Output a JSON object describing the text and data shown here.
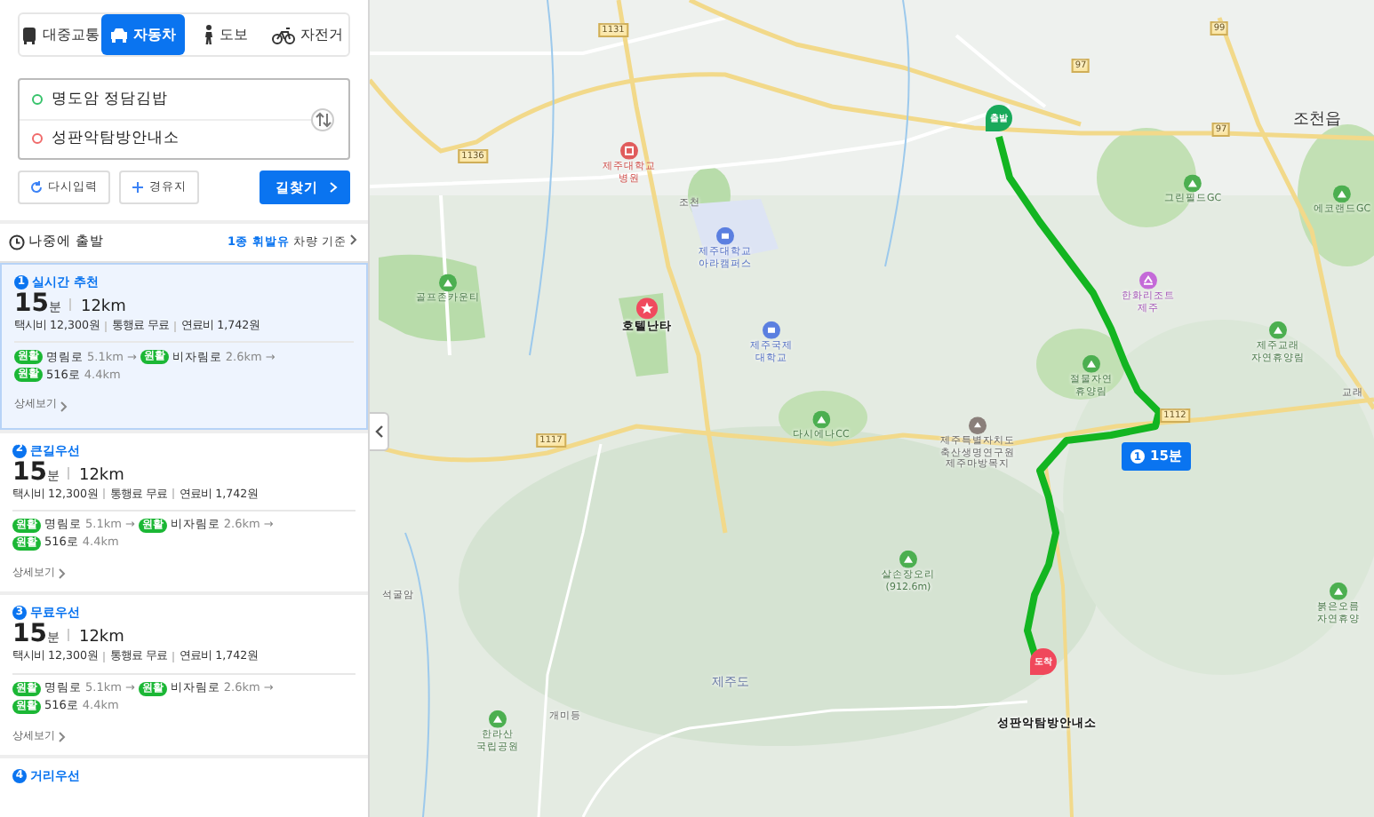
{
  "modes": [
    {
      "label": "대중교통",
      "kind": "bus",
      "selected": false
    },
    {
      "label": "자동차",
      "kind": "car",
      "selected": true
    },
    {
      "label": "도보",
      "kind": "walk",
      "selected": false
    },
    {
      "label": "자전거",
      "kind": "bike",
      "selected": false
    }
  ],
  "route_inputs": {
    "origin": "명도암 정담김밥",
    "destination": "성판악탐방안내소"
  },
  "actions": {
    "reset": "다시입력",
    "waypoint": "경유지",
    "search": "길찾기"
  },
  "departure": {
    "label": "나중에 출발",
    "vehicle": "**1종 휘발유** 차량 기준"
  },
  "routes": [
    {
      "number": "1",
      "title": "실시간 추천",
      "selected": true,
      "time": "15",
      "time_unit": "분",
      "distance": "12km",
      "costs": [
        "택시비 12,300원",
        "통행료 무료",
        "연료비 1,742원"
      ],
      "roads": [
        {
          "status": "원활",
          "name": "명림로",
          "length": "5.1km",
          "arrow": "→"
        },
        {
          "status": "원활",
          "name": "비자림로",
          "length": "2.6km",
          "arrow": "→"
        },
        {
          "status": "원활",
          "name": "516로",
          "length": "4.4km"
        }
      ],
      "details": "상세보기"
    },
    {
      "number": "2",
      "title": "큰길우선",
      "selected": false,
      "time": "15",
      "time_unit": "분",
      "distance": "12km",
      "costs": [
        "택시비 12,300원",
        "통행료 무료",
        "연료비 1,742원"
      ],
      "roads": [
        {
          "status": "원활",
          "name": "명림로",
          "length": "5.1km",
          "arrow": "→"
        },
        {
          "status": "원활",
          "name": "비자림로",
          "length": "2.6km",
          "arrow": "→"
        },
        {
          "status": "원활",
          "name": "516로",
          "length": "4.4km"
        }
      ],
      "details": "상세보기"
    },
    {
      "number": "3",
      "title": "무료우선",
      "selected": false,
      "time": "15",
      "time_unit": "분",
      "distance": "12km",
      "costs": [
        "택시비 12,300원",
        "통행료 무료",
        "연료비 1,742원"
      ],
      "roads": [
        {
          "status": "원활",
          "name": "명림로",
          "length": "5.1km",
          "arrow": "→"
        },
        {
          "status": "원활",
          "name": "비자림로",
          "length": "2.6km",
          "arrow": "→"
        },
        {
          "status": "원활",
          "name": "516로",
          "length": "4.4km"
        }
      ],
      "details": "상세보기"
    },
    {
      "number": "4",
      "title": "거리우선",
      "selected": false
    }
  ],
  "map": {
    "labels": [
      {
        "kind": "road",
        "text": "1131"
      },
      {
        "kind": "road",
        "text": "1136"
      },
      {
        "kind": "hospital",
        "text": "제주대학교\n병원"
      },
      {
        "kind": "place",
        "text": "조천"
      },
      {
        "kind": "school",
        "text": "제주대학교\n아라캠퍼스"
      },
      {
        "kind": "park",
        "text": "골프존카운티"
      },
      {
        "kind": "star",
        "text": "호텔난타"
      },
      {
        "kind": "school",
        "text": "제주국제\n대학교"
      },
      {
        "kind": "road",
        "text": "97"
      },
      {
        "kind": "road",
        "text": "99"
      },
      {
        "kind": "road",
        "text": "97"
      },
      {
        "kind": "town",
        "text": "조천읍"
      },
      {
        "kind": "park",
        "text": "그린필드GC"
      },
      {
        "kind": "park",
        "text": "에코랜드GC"
      },
      {
        "kind": "resort",
        "text": "한화리조트\n제주"
      },
      {
        "kind": "park",
        "text": "제주교래\n자연휴양림"
      },
      {
        "kind": "park",
        "text": "절물자연\n휴양림"
      },
      {
        "kind": "road",
        "text": "1117"
      },
      {
        "kind": "road",
        "text": "1112"
      },
      {
        "kind": "park",
        "text": "다시에나CC"
      },
      {
        "kind": "poi",
        "text": "제주특별자치도\n축산생명연구원\n제주마방목지"
      },
      {
        "kind": "park",
        "text": "살손장오리\n(912.6m)"
      },
      {
        "kind": "area",
        "text": "제주도"
      },
      {
        "kind": "park",
        "text": "한라산\n국립공원"
      },
      {
        "kind": "place",
        "text": "석굴암"
      },
      {
        "kind": "place",
        "text": "개미등"
      },
      {
        "kind": "place",
        "text": "교래"
      },
      {
        "kind": "park",
        "text": "붉은오름\n자연휴양"
      },
      {
        "kind": "dest",
        "text": "성판악탐방안내소"
      }
    ],
    "start": "출발",
    "end": "도착",
    "route_badge": {
      "number": "1",
      "time": "15분"
    }
  }
}
